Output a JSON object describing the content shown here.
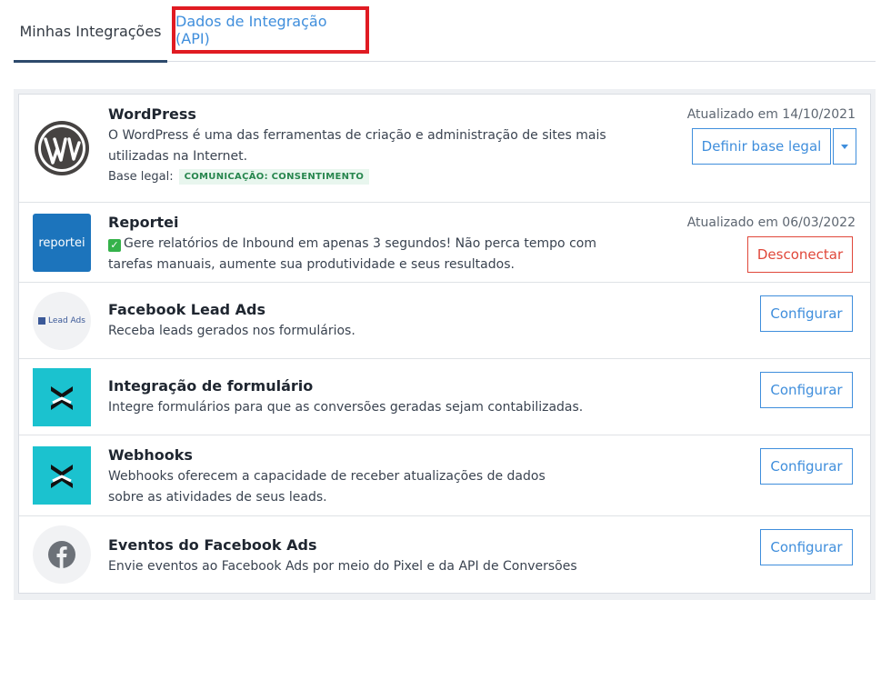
{
  "tabs": [
    {
      "label": "Minhas Integrações",
      "active": true
    },
    {
      "label": "Dados de Integração (API)",
      "active": false
    }
  ],
  "integrations": [
    {
      "name": "WordPress",
      "icon": "wordpress-logo-icon",
      "description": "O WordPress é uma das ferramentas de criação e administração de sites mais utilizadas na Internet.",
      "legal_label": "Base legal:",
      "legal_badge": "COMUNICAÇÃO: CONSENTIMENTO",
      "updated": "Atualizado em 14/10/2021",
      "action": "Definir base legal"
    },
    {
      "name": "Reportei",
      "icon": "reportei-logo-icon",
      "logo_text": "reportei",
      "description": "Gere relatórios de Inbound em apenas 3 segundos! Não perca tempo com tarefas manuais, aumente sua produtividade e seus resultados.",
      "updated": "Atualizado em 06/03/2022",
      "action": "Desconectar"
    },
    {
      "name": "Facebook Lead Ads",
      "icon": "facebook-lead-ads-logo-icon",
      "logo_text": "Lead Ads",
      "description": "Receba leads gerados nos formulários.",
      "action": "Configurar"
    },
    {
      "name": "Integração de formulário",
      "icon": "form-integration-logo-icon",
      "description": "Integre formulários para que as conversões geradas sejam contabilizadas.",
      "action": "Configurar"
    },
    {
      "name": "Webhooks",
      "icon": "webhooks-logo-icon",
      "description": "Webhooks oferecem a capacidade de receber atualizações de dados sobre as atividades de seus leads.",
      "action": "Configurar"
    },
    {
      "name": "Eventos do Facebook Ads",
      "icon": "facebook-logo-icon",
      "description": "Envie eventos ao Facebook Ads por meio do Pixel e da API de Conversões",
      "action": "Configurar"
    }
  ],
  "colors": {
    "accent": "#3f8edc",
    "danger": "#e0473a",
    "highlight_box": "#e01b22",
    "active_tab_underline": "#2d4a6c",
    "badge_bg": "#e8f6ee",
    "badge_text": "#27864e",
    "rdstation_teal": "#1bc2cf",
    "reportei_blue": "#1c74bc"
  }
}
